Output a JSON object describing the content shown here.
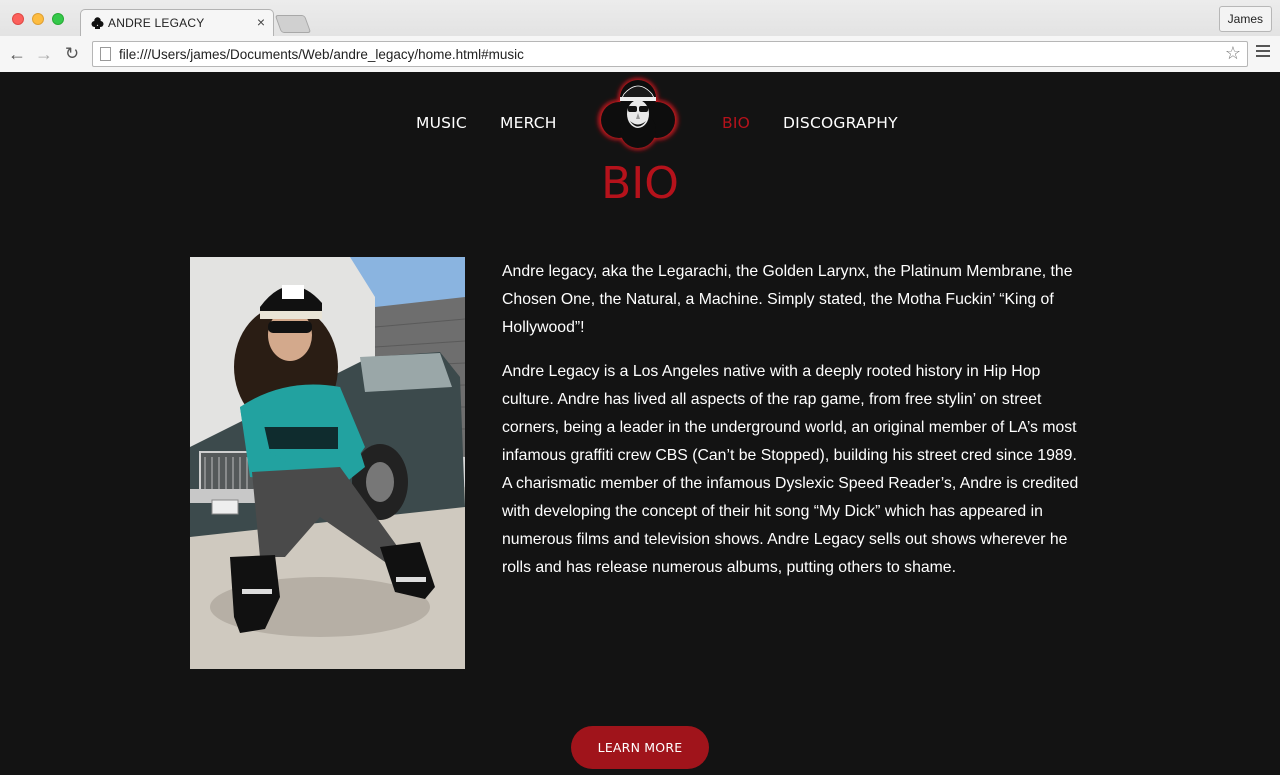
{
  "browser": {
    "tab_title": "ANDRE LEGACY",
    "tab_close": "×",
    "profile_name": "James",
    "url": "file:///Users/james/Documents/Web/andre_legacy/home.html#music"
  },
  "nav": {
    "music": "MUSIC",
    "merch": "MERCH",
    "bio": "BIO",
    "discography": "DISCOGRAPHY",
    "active": "BIO"
  },
  "section": {
    "title": "BIO"
  },
  "bio": {
    "paragraphs": [
      "Andre legacy, aka the Legarachi, the Golden Larynx, the Platinum Membrane, the Chosen One, the Natural, a Machine. Simply stated, the Motha Fuckin’ “King of Hollywood”!",
      "Andre Legacy is a Los Angeles native with a deeply rooted history in Hip Hop culture. Andre has lived all aspects of the rap game, from free stylin’ on street corners, being a leader in the underground world, an original member of LA’s most infamous graffiti crew CBS (Can’t be Stopped), building his street cred since 1989. A charismatic member of the infamous Dyslexic Speed Reader’s, Andre is credited with developing the concept of their hit song “My Dick” which has appeared in numerous films and television shows. Andre Legacy sells out shows wherever he rolls and has release numerous albums, putting others to shame."
    ]
  },
  "cta": {
    "learn_more": "LEARN MORE"
  },
  "colors": {
    "accent": "#b5121b",
    "background": "#131313",
    "button": "#a0141b"
  }
}
